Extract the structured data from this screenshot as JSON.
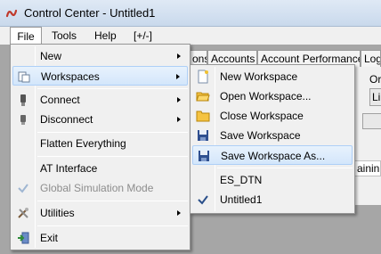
{
  "window": {
    "title": "Control Center - Untitled1"
  },
  "menubar": {
    "items": [
      "File",
      "Tools",
      "Help",
      "[+/-]"
    ]
  },
  "tabs": [
    "ons",
    "Accounts",
    "Account Performance",
    "Log"
  ],
  "right_panel": {
    "text1": "Or",
    "text2": "Lir",
    "grid_text": "ainin"
  },
  "file_menu": {
    "new": "New",
    "workspaces": "Workspaces",
    "connect": "Connect",
    "disconnect": "Disconnect",
    "flatten": "Flatten Everything",
    "at_interface": "AT Interface",
    "global_sim": "Global Simulation Mode",
    "utilities": "Utilities",
    "exit": "Exit"
  },
  "workspaces_menu": {
    "new_ws": "New Workspace",
    "open_ws": "Open Workspace...",
    "close_ws": "Close Workspace",
    "save_ws": "Save Workspace",
    "save_as": "Save Workspace As...",
    "es_dtn": "ES_DTN",
    "untitled": "Untitled1"
  }
}
